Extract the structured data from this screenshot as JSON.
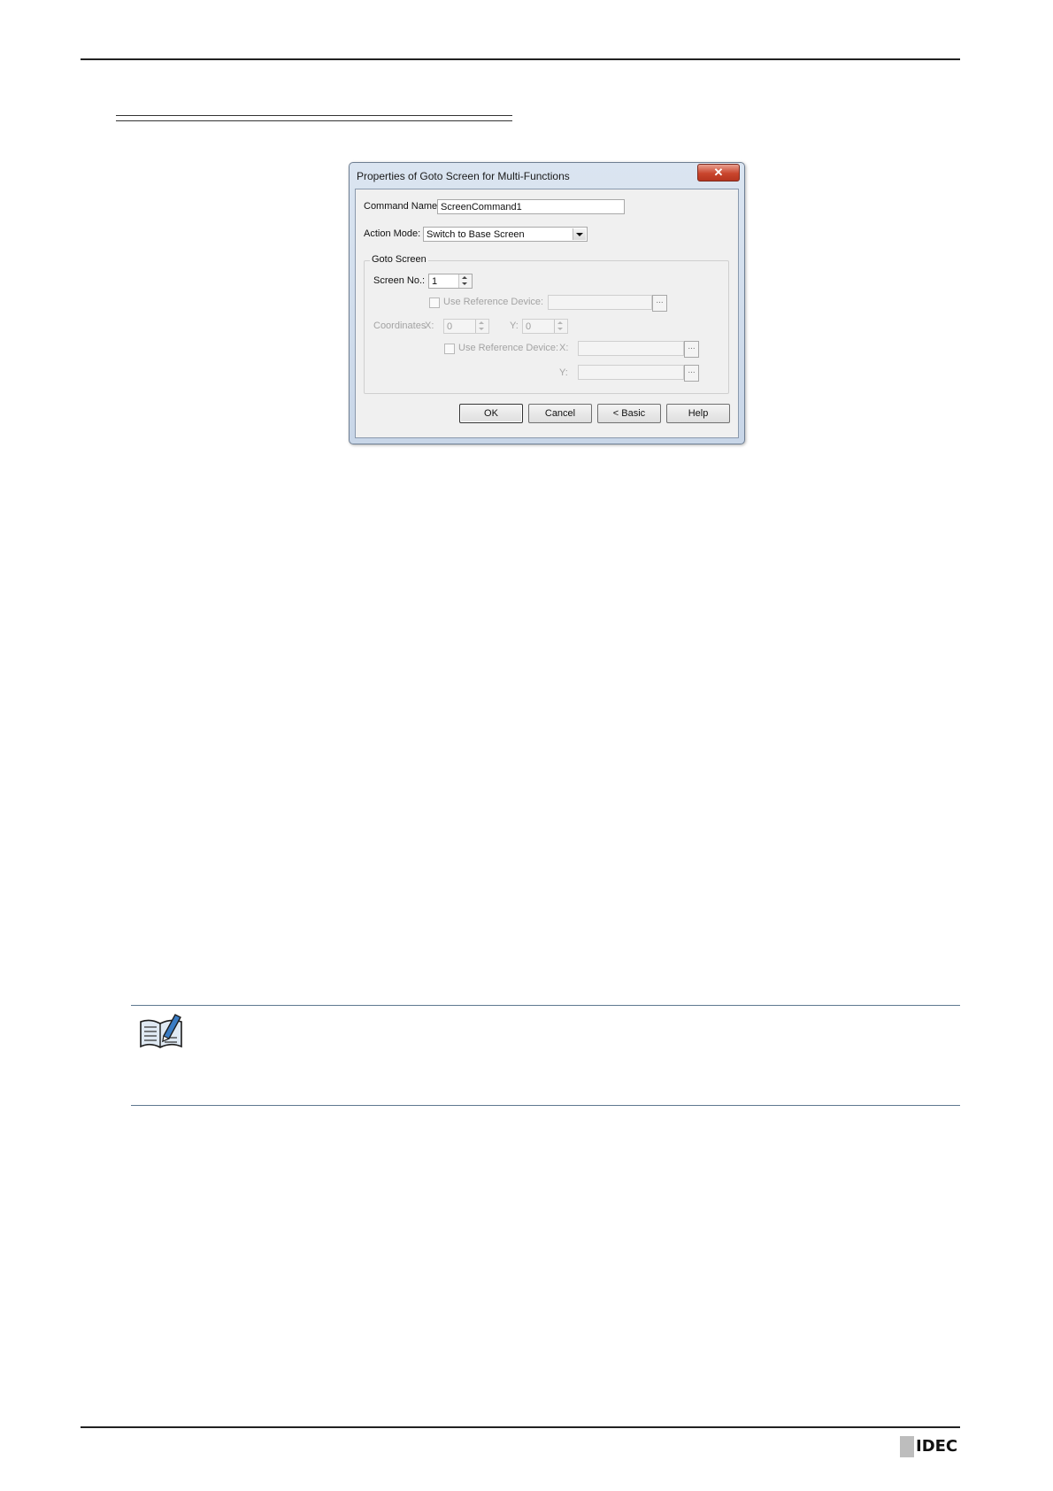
{
  "dialog": {
    "title": "Properties of Goto Screen  for Multi-Functions",
    "close_glyph": "✕",
    "command_name_label": "Command Name:",
    "command_name_value": "ScreenCommand1",
    "action_mode_label": "Action Mode:",
    "action_mode_value": "Switch to Base Screen",
    "group_title": "Goto Screen",
    "screen_no_label": "Screen No.:",
    "screen_no_value": "1",
    "use_ref_device_label": "Use Reference Device:",
    "coordinates_label": "Coordinates",
    "x_label": "X:",
    "x_value": "0",
    "y_label": "Y:",
    "y_value": "0",
    "use_ref_device_label2": "Use Reference Device:",
    "ref_x_label": "X:",
    "ref_y_label": "Y:",
    "browse_glyph": "...",
    "buttons": {
      "ok": "OK",
      "cancel": "Cancel",
      "basic": "< Basic",
      "help": "Help"
    }
  },
  "icons": {
    "note": "note-book-pencil-icon"
  },
  "footer": {
    "logo_text": "IDEC"
  }
}
